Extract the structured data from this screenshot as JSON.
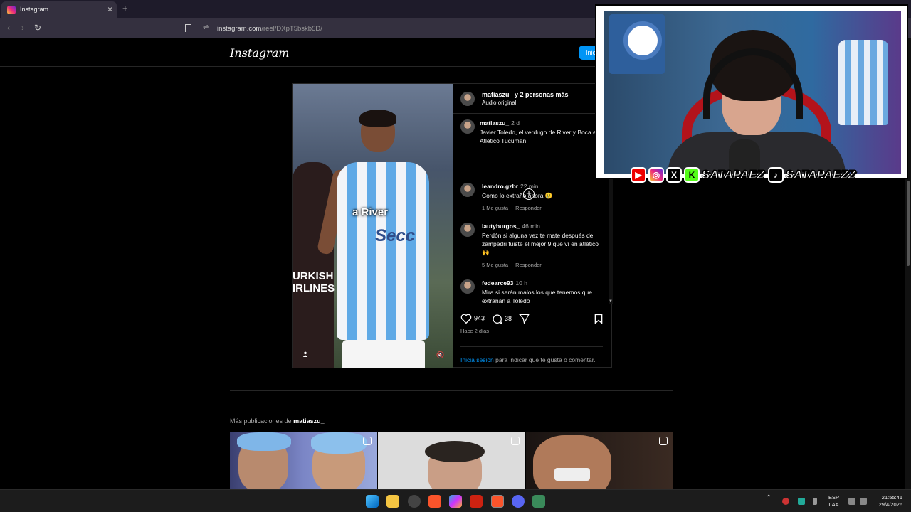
{
  "browser": {
    "tab_title": "Instagram",
    "url_domain": "instagram.com",
    "url_path": "/reel/DXpT5bskb5D/"
  },
  "instagram": {
    "logo": "Instagram",
    "login_button": "Inic",
    "post": {
      "header_user": "matiaszu_ y 2 personas más",
      "header_audio": "Audio original",
      "caption_user": "matiaszu_",
      "caption_time": "2 d",
      "caption_text": "Javier Toledo, el verdugo de River y Boca en Atlético Tucumán",
      "video_overlay_text": "a River",
      "video_sponsor_text": "URKISH\nIRLINES",
      "video_brand_text": "Secc",
      "comments": [
        {
          "user": "leandro.gzbr",
          "time": "22 min",
          "text": "Como lo extraño ahora 🥲",
          "likes": "1 Me gusta",
          "reply": "Responder"
        },
        {
          "user": "lautyburgos_",
          "time": "46 min",
          "text": "Perdón si alguna vez te mate después de zampedri fuiste el mejor 9 que ví en atlético🙌",
          "likes": "5 Me gusta",
          "reply": "Responder"
        },
        {
          "user": "fedearce93",
          "time": "10 h",
          "text": "Mira si serán malos los que tenemos que extrañan a Toledo",
          "likes": "",
          "reply": ""
        }
      ],
      "likes_count": "943",
      "comments_count": "38",
      "posted_ago": "Hace 2 días",
      "login_link": "Inicia sesión",
      "login_text": " para indicar que te gusta o comentar."
    },
    "more_posts_prefix": "Más publicaciones de ",
    "more_posts_user": "matiaszu_"
  },
  "overlay": {
    "social_handle_1": "SATAPAEZ",
    "social_handle_2": "SATAPAEZZ",
    "x_label": "X",
    "kick_label": "K"
  },
  "taskbar": {
    "lang_1": "ESP",
    "lang_2": "LAA",
    "time": "21:55:41",
    "date": "29/4/2026"
  },
  "colors": {
    "ig_blue": "#0095f6",
    "browser_dark": "#34303f"
  }
}
